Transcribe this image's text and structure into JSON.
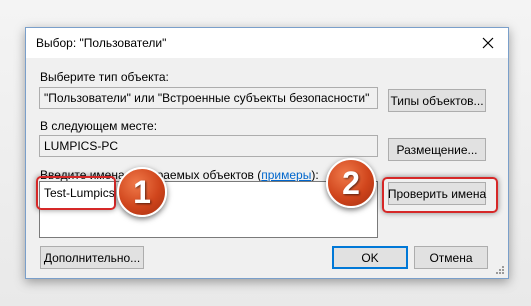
{
  "window": {
    "title": "Выбор: \"Пользователи\""
  },
  "object_type": {
    "label": "Выберите тип объекта:",
    "value": "\"Пользователи\" или \"Встроенные субъекты безопасности\"",
    "button_label": "Типы объектов..."
  },
  "location": {
    "label": "В следующем месте:",
    "value": "LUMPICS-PC",
    "button_label": "Размещение..."
  },
  "names": {
    "label_before": "Введите имена выбираемых объектов (",
    "link_label": "примеры",
    "label_after": "):",
    "input_value": "Test-Lumpics",
    "check_button_label": "Проверить имена"
  },
  "footer": {
    "advanced_label": "Дополнительно...",
    "ok_label": "OK",
    "cancel_label": "Отмена"
  },
  "annotations": {
    "step1": "1",
    "step2": "2",
    "highlight_color": "#d62828",
    "badge_color": "#d0451c"
  },
  "icons": {
    "close": "close-icon",
    "resize": "resize-grip-icon"
  }
}
